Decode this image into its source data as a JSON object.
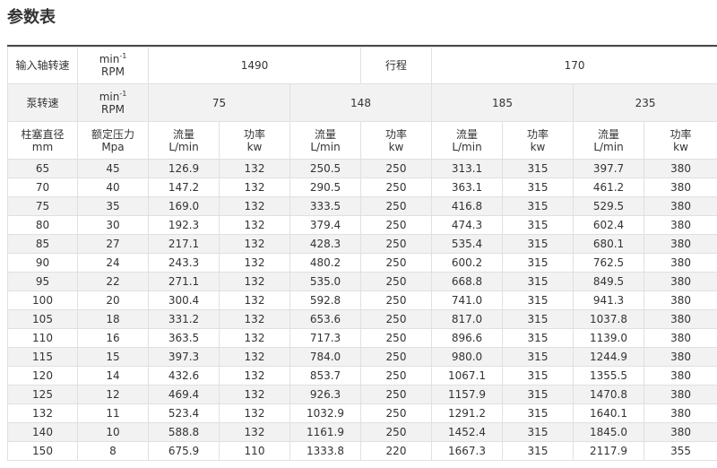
{
  "title": "参数表",
  "header": {
    "input_speed_label": "输入轴转速",
    "unit_min": "min",
    "unit_min_sup": "-1",
    "unit_rpm": "RPM",
    "input_speed_value": "1490",
    "stroke_label": "行程",
    "stroke_value": "170",
    "pump_speed_label": "泵转速",
    "pump_speeds": [
      "75",
      "148",
      "185",
      "235"
    ]
  },
  "subheader": {
    "plunger_label": "柱塞直径",
    "plunger_unit": "mm",
    "pressure_label": "额定压力",
    "pressure_unit": "Mpa",
    "flow_label": "流量",
    "flow_unit": "L/min",
    "power_label": "功率",
    "power_unit": "kw"
  },
  "rows": [
    [
      "65",
      "45",
      "126.9",
      "132",
      "250.5",
      "250",
      "313.1",
      "315",
      "397.7",
      "380"
    ],
    [
      "70",
      "40",
      "147.2",
      "132",
      "290.5",
      "250",
      "363.1",
      "315",
      "461.2",
      "380"
    ],
    [
      "75",
      "35",
      "169.0",
      "132",
      "333.5",
      "250",
      "416.8",
      "315",
      "529.5",
      "380"
    ],
    [
      "80",
      "30",
      "192.3",
      "132",
      "379.4",
      "250",
      "474.3",
      "315",
      "602.4",
      "380"
    ],
    [
      "85",
      "27",
      "217.1",
      "132",
      "428.3",
      "250",
      "535.4",
      "315",
      "680.1",
      "380"
    ],
    [
      "90",
      "24",
      "243.3",
      "132",
      "480.2",
      "250",
      "600.2",
      "315",
      "762.5",
      "380"
    ],
    [
      "95",
      "22",
      "271.1",
      "132",
      "535.0",
      "250",
      "668.8",
      "315",
      "849.5",
      "380"
    ],
    [
      "100",
      "20",
      "300.4",
      "132",
      "592.8",
      "250",
      "741.0",
      "315",
      "941.3",
      "380"
    ],
    [
      "105",
      "18",
      "331.2",
      "132",
      "653.6",
      "250",
      "817.0",
      "315",
      "1037.8",
      "380"
    ],
    [
      "110",
      "16",
      "363.5",
      "132",
      "717.3",
      "250",
      "896.6",
      "315",
      "1139.0",
      "380"
    ],
    [
      "115",
      "15",
      "397.3",
      "132",
      "784.0",
      "250",
      "980.0",
      "315",
      "1244.9",
      "380"
    ],
    [
      "120",
      "14",
      "432.6",
      "132",
      "853.7",
      "250",
      "1067.1",
      "315",
      "1355.5",
      "380"
    ],
    [
      "125",
      "12",
      "469.4",
      "132",
      "926.3",
      "250",
      "1157.9",
      "315",
      "1470.8",
      "380"
    ],
    [
      "132",
      "11",
      "523.4",
      "132",
      "1032.9",
      "250",
      "1291.2",
      "315",
      "1640.1",
      "380"
    ],
    [
      "140",
      "10",
      "588.8",
      "132",
      "1161.9",
      "250",
      "1452.4",
      "315",
      "1845.0",
      "380"
    ],
    [
      "150",
      "8",
      "675.9",
      "110",
      "1333.8",
      "220",
      "1667.3",
      "315",
      "2117.9",
      "355"
    ]
  ]
}
